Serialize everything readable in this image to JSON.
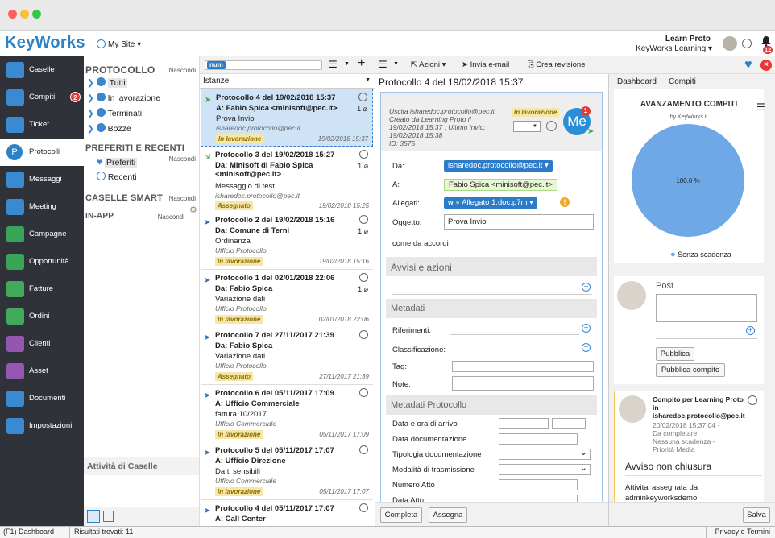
{
  "app": {
    "logo": "KeyWorks",
    "site": "My Site ▾",
    "user_name": "Learn Proto",
    "user_org": "KeyWorks Learning ▾",
    "notif_count": "12"
  },
  "nav": [
    {
      "label": "Caselle",
      "icon": "inbox-icon"
    },
    {
      "label": "Compiti",
      "icon": "tasks-icon",
      "badge": "2"
    },
    {
      "label": "Ticket",
      "icon": "ticket-icon"
    },
    {
      "label": "Protocolli",
      "icon": "protocol-icon"
    },
    {
      "label": "Messaggi",
      "icon": "envelope-icon"
    },
    {
      "label": "Meeting",
      "icon": "people-icon"
    },
    {
      "label": "Campagne",
      "icon": "campaign-icon"
    },
    {
      "label": "Opportunità",
      "icon": "target-icon"
    },
    {
      "label": "Fatture",
      "icon": "invoice-icon"
    },
    {
      "label": "Ordini",
      "icon": "cart-icon"
    },
    {
      "label": "Clienti",
      "icon": "user-icon"
    },
    {
      "label": "Asset",
      "icon": "asset-icon"
    },
    {
      "label": "Documenti",
      "icon": "cloud-icon"
    },
    {
      "label": "Impostazioni",
      "icon": "gear-icon"
    }
  ],
  "panel": {
    "protocollo": "PROTOCOLLO",
    "hide1": "Nascondi",
    "items": [
      "Tutti",
      "In lavorazione",
      "Terminati",
      "Bozze"
    ],
    "preferiti_title": "PREFERITI E RECENTI",
    "hide2": "Nascondi",
    "fav": [
      "Preferiti",
      "Recenti"
    ],
    "caselle_smart": "CASELLE SMART",
    "hide3": "Nascondi",
    "inapp": "IN-APP",
    "hide4": "Nascondi",
    "activity": "Attività di Caselle"
  },
  "list": {
    "search_tag": "num",
    "filter": "Istanze",
    "items": [
      {
        "t1": "Protocollo 4 del 19/02/2018 15:37",
        "t2": "A: Fabio Spica <minisoft@pec.it>",
        "t3": "Prova Invio",
        "t4": "isharedoc.protocollo@pec.it",
        "badge": "In lavorazione",
        "date": "19/02/2018 15:37",
        "att": "1"
      },
      {
        "t1": "Protocollo 3 del 19/02/2018 15:27",
        "t2": "Da: Minisoft di Fabio Spica <minisoft@pec.it>",
        "t3": "Messaggio di test",
        "t4": "isharedoc.protocollo@pec.it",
        "badge": "Assegnato",
        "date": "19/02/2018 15:25",
        "att": "1"
      },
      {
        "t1": "Protocollo 2 del 19/02/2018 15:16",
        "t2": "Da: Comune di Terni",
        "t3": "Ordinanza",
        "t4": "Ufficio Protocollo",
        "badge": "In lavorazione",
        "date": "19/02/2018 15:16",
        "att": "1"
      },
      {
        "t1": "Protocollo 1 del 02/01/2018 22:06",
        "t2": "Da: Fabio Spica",
        "t3": "Variazione dati",
        "t4": "Ufficio Protocollo",
        "badge": "In lavorazione",
        "date": "02/01/2018 22:06",
        "att": "1"
      },
      {
        "t1": "Protocollo 7 del 27/11/2017 21:39",
        "t2": "Da: Fabio Spica",
        "t3": "Variazione dati",
        "t4": "Ufficio Protocollo",
        "badge": "Assegnato",
        "date": "27/11/2017 21:39",
        "att": ""
      },
      {
        "t1": "Protocollo 6 del 05/11/2017 17:09",
        "t2": "A: Ufficio Commerciale",
        "t3": "fattura 10/2017",
        "t4": "Ufficio Commerciale",
        "badge": "In lavorazione",
        "date": "05/11/2017 17:09",
        "att": ""
      },
      {
        "t1": "Protocollo 5 del 05/11/2017 17:07",
        "t2": "A: Ufficio Direzione",
        "t3": "Da ti sensibili",
        "t4": "Ufficio Commerciale",
        "badge": "In lavorazione",
        "date": "05/11/2017 17:07",
        "att": ""
      },
      {
        "t1": "Protocollo 4 del 05/11/2017 17:07",
        "t2": "A: Call Center",
        "t3": "",
        "t4": "",
        "badge": "",
        "date": "",
        "att": ""
      }
    ]
  },
  "toolbar": {
    "azioni": "Azioni ▾",
    "invia": "Invia e-mail",
    "crea": "Crea revisione"
  },
  "detail": {
    "title": "Protocollo 4 del 19/02/2018 15:37",
    "meta1": "Uscita isharedoc.protocollo@pec.it",
    "meta2": "Creato da Learning Proto il",
    "meta3": "19/02/2018 15:37 , Ultimo invio:",
    "meta4": "19/02/2018 15:38",
    "meta5": "ID: 3575",
    "status": "In lavorazione",
    "avatar": "Me",
    "avatar_badge": "1",
    "da_label": "Da:",
    "da_value": "isharedoc.protocollo@pec.it ▾",
    "a_label": "A:",
    "a_value": "Fabio Spica <minisoft@pec.it>",
    "allegati_label": "Allegati:",
    "allegati_value": "Allegato 1.doc.p7m ▾",
    "oggetto_label": "Oggetto:",
    "oggetto_value": "Prova Invio",
    "body": "come da accordi",
    "avvisi": "Avvisi e azioni",
    "metadati": "Metadati",
    "riferimenti": "Riferimenti:",
    "classificazione": "Classificazione:",
    "tag": "Tag:",
    "note": "Note:",
    "metadati_prot": "Metadati Protocollo",
    "mp_fields": [
      "Data e ora di arrivo",
      "Data documentazione",
      "Tipologia documentazione",
      "Modalità di trasmissione",
      "Numero Atto",
      "Data Atto"
    ],
    "btn_completa": "Completa",
    "btn_assegna": "Assegna",
    "btn_salva": "Salva"
  },
  "right": {
    "tab1": "Dashboard",
    "tab2": "Compiti",
    "chart_title": "AVANZAMENTO COMPITI",
    "chart_sub": "by KeyWorks.it",
    "legend": "Senza scadenza",
    "post_title": "Post",
    "btn_pubblica": "Pubblica",
    "btn_pubblica_compito": "Pubblica compito",
    "task_title": "Compito per Learning Proto in isharedoc.protocollo@pec.it",
    "task_date": "20/02/2018 15:37:04 -",
    "task_status": "Da completare",
    "task_scad": "Nessuna scadenza -",
    "task_prio": "Priorità Media",
    "task_heading": "Avviso non chiusura",
    "task_body1": "Attivita' assegnata da",
    "task_body2": "adminkeyworksdemo"
  },
  "chart_data": {
    "type": "pie",
    "title": "AVANZAMENTO COMPITI",
    "subtitle": "by KeyWorks.it",
    "slices": [
      {
        "label": "Senza scadenza",
        "value": 100,
        "display": "100.0 %",
        "color": "#6ea8e6"
      }
    ],
    "legend": "bottom"
  },
  "status": {
    "f1": "(F1) Dashboard",
    "results": "Risultati trovati: 11",
    "privacy": "Privacy e Termini"
  },
  "colors": {
    "accent": "#2a82c8",
    "sidebar": "#2f3339",
    "badge_red": "#e53935",
    "chip": "#2b7bc8"
  }
}
